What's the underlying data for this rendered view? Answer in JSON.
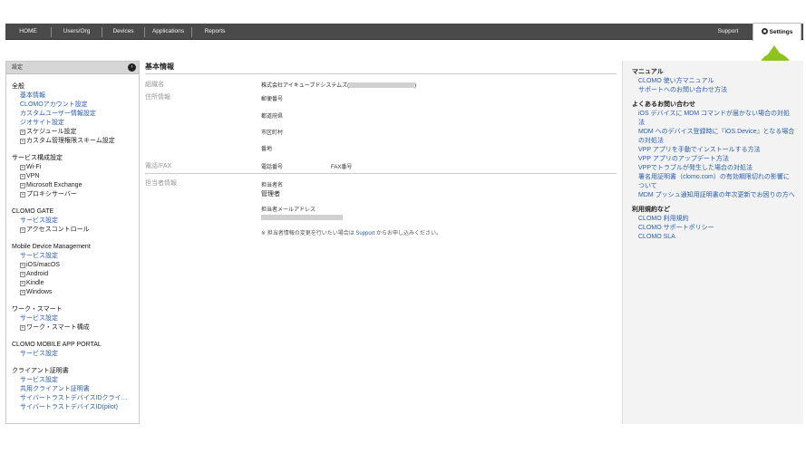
{
  "nav": {
    "items": [
      {
        "label": "HOME"
      },
      {
        "label": "Users/Org"
      },
      {
        "label": "Devices"
      },
      {
        "label": "Applications"
      },
      {
        "label": "Reports"
      }
    ],
    "support": "Support",
    "settings": "Settings"
  },
  "callout": "1",
  "sidebar": {
    "header": "設定",
    "collapse_glyph": "‹",
    "sections": [
      {
        "title": "全般",
        "items": [
          {
            "type": "link",
            "label": "基本情報"
          },
          {
            "type": "link",
            "label": "CLOMOアカウント設定"
          },
          {
            "type": "link",
            "label": "カスタムユーザー情報設定"
          },
          {
            "type": "link",
            "label": "ジオサイト設定"
          },
          {
            "type": "tree",
            "label": "スケジュール設定"
          },
          {
            "type": "tree",
            "label": "カスタム管理権限スキーム設定"
          }
        ]
      },
      {
        "title": "サービス構成設定",
        "items": [
          {
            "type": "tree",
            "label": "Wi-Fi"
          },
          {
            "type": "tree",
            "label": "VPN"
          },
          {
            "type": "tree",
            "label": "Microsoft Exchange"
          },
          {
            "type": "tree",
            "label": "プロキシサーバー"
          }
        ]
      },
      {
        "title": "CLOMO GATE",
        "items": [
          {
            "type": "link",
            "label": "サービス設定"
          },
          {
            "type": "tree",
            "label": "アクセスコントロール"
          }
        ]
      },
      {
        "title": "Mobile Device Management",
        "items": [
          {
            "type": "link",
            "label": "サービス設定"
          },
          {
            "type": "tree",
            "label": "iOS/macOS"
          },
          {
            "type": "tree",
            "label": "Android"
          },
          {
            "type": "tree",
            "label": "Kindle"
          },
          {
            "type": "tree",
            "label": "Windows"
          }
        ]
      },
      {
        "title": "ワーク・スマート",
        "items": [
          {
            "type": "link",
            "label": "サービス設定"
          },
          {
            "type": "tree",
            "label": "ワーク・スマート構成"
          }
        ]
      },
      {
        "title": "CLOMO MOBILE APP PORTAL",
        "items": [
          {
            "type": "link",
            "label": "サービス設定"
          }
        ]
      },
      {
        "title": "クライアント証明書",
        "items": [
          {
            "type": "link",
            "label": "サービス設定"
          },
          {
            "type": "link",
            "label": "共用クライアント証明書"
          },
          {
            "type": "link",
            "label": "サイバートラストデバイスIDクライ…"
          },
          {
            "type": "link",
            "label": "サイバートラストデバイスID(pilot)"
          }
        ]
      }
    ]
  },
  "main": {
    "title": "基本情報",
    "org_label": "組織名",
    "org_value_prefix": "株式会社アイキューブドシステムズ(",
    "org_value_suffix": ")",
    "address_label": "住所情報",
    "postal_label": "郵便番号",
    "prefecture_label": "都道府県",
    "city_label": "市区町村",
    "street_label": "番地",
    "phone_fax_label": "電話/FAX",
    "phone_label": "電話番号",
    "fax_label": "FAX番号",
    "contact_label": "担当者情報",
    "contact_name_label": "担当者名",
    "contact_name_value": "管理者",
    "contact_email_label": "担当者メールアドレス",
    "note_prefix": "※ 担当者情報の変更を行いたい場合は ",
    "note_link": "Support",
    "note_suffix": " からお申し込みください。"
  },
  "right": {
    "sections": [
      {
        "title": "マニュアル",
        "links": [
          "CLOMO 使い方マニュアル",
          "サポートへのお問い合わせ方法"
        ]
      },
      {
        "title": "よくあるお問い合わせ",
        "links": [
          "iOS デバイスに MDM コマンドが届かない場合の対処法",
          "MDM へのデバイス登録時に『iOS Device』となる場合の対処法",
          "VPP アプリを手動でインストールする方法",
          "VPP アプリのアップデート方法",
          "VPPでトラブルが発生した場合の対処法",
          "署名用証明書（clomo.com）の有効期限切れの影響について",
          "MDM プッシュ通知用証明書の年次更新でお困りの方へ"
        ]
      },
      {
        "title": "利用規約など",
        "links": [
          "CLOMO 利用規約",
          "CLOMO サポートポリシー",
          "CLOMO SLA"
        ]
      }
    ]
  }
}
